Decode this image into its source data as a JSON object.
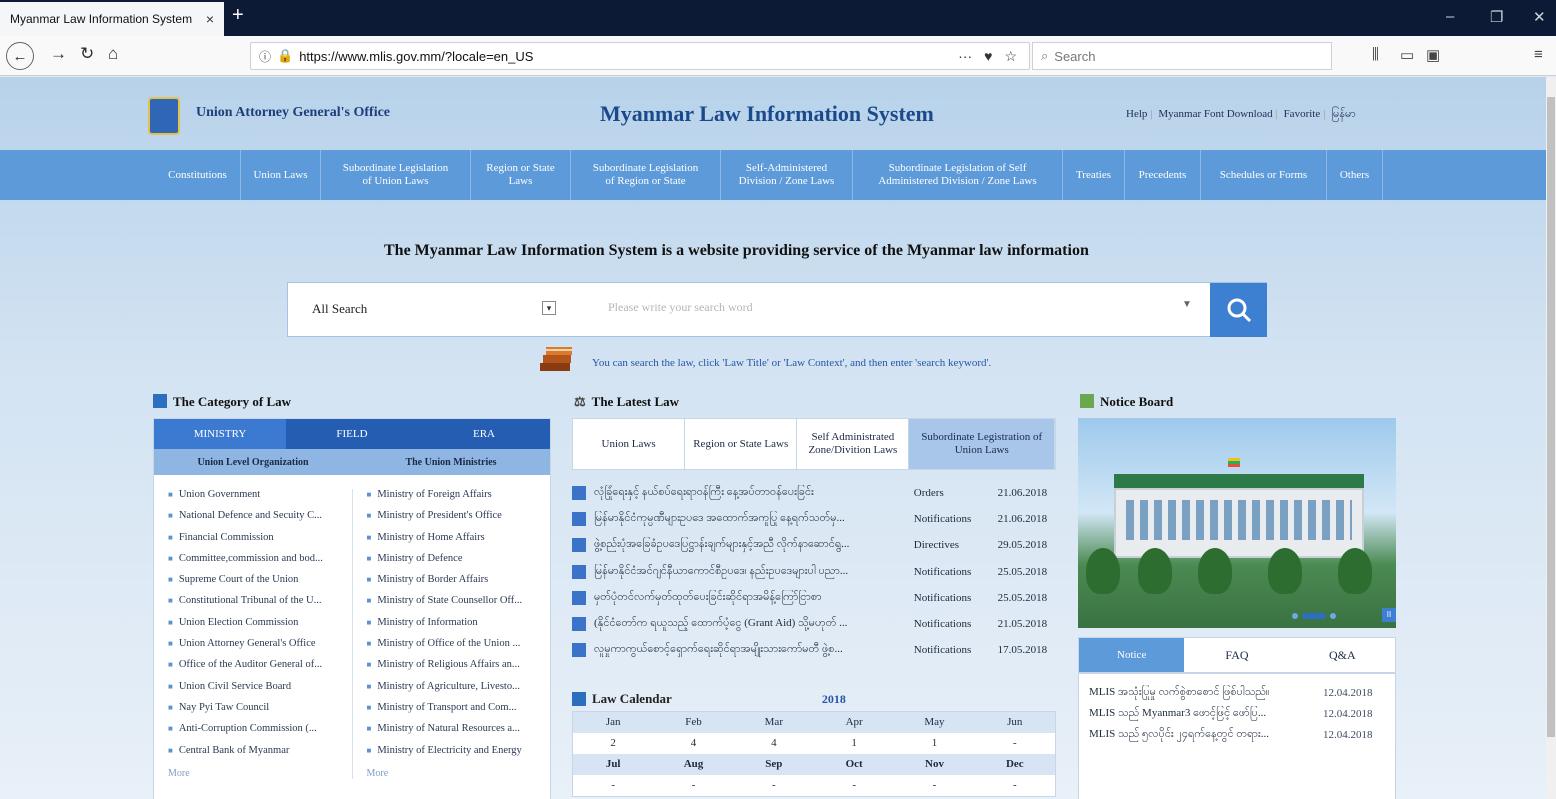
{
  "browser": {
    "tab_title": "Myanmar Law Information System",
    "tab_close": "×",
    "new_tab": "+",
    "url": "https://www.mlis.gov.mm/?locale=en_US",
    "page_actions": "···",
    "search_placeholder": "Search",
    "win_minimize": "–",
    "win_restore": "❐",
    "win_close": "✕"
  },
  "header": {
    "org_name": "Union Attorney General's Office",
    "site_title": "Myanmar Law Information System",
    "links": [
      "Help",
      "Myanmar Font Download",
      "Favorite",
      "မြန်မာ"
    ]
  },
  "menu": [
    "Constitutions",
    "Union Laws",
    "Subordinate Legislation of Union Laws",
    "Region or State Laws",
    "Subordinate Legislation of Region or State",
    "Self-Administered Division / Zone Laws",
    "Subordinate Legislation of Self Administered Division / Zone Laws",
    "Treaties",
    "Precedents",
    "Schedules or Forms",
    "Others"
  ],
  "tagline": "The Myanmar Law Information System is a website providing service of the Myanmar law information",
  "search": {
    "select_value": "All Search",
    "placeholder": "Please write your search word",
    "hint": "You can search the law, click 'Law Title' or 'Law Context', and then enter 'search keyword'."
  },
  "category": {
    "title": "The Category of Law",
    "tabs": [
      "MINISTRY",
      "FIELD",
      "ERA"
    ],
    "sub_headers": [
      "Union Level Organization",
      "The Union Ministries"
    ],
    "left_items": [
      "Union Government",
      "National Defence and Secuity C...",
      "Financial Commission",
      "Committee,commission and bod...",
      "Supreme Court of the Union",
      "Constitutional Tribunal of the U...",
      "Union Election Commission",
      "Union Attorney General's Office",
      "Office of the Auditor General of...",
      "Union Civil Service Board",
      "Nay Pyi Taw Council",
      "Anti-Corruption Commission (...",
      "Central Bank of Myanmar"
    ],
    "right_items": [
      "Ministry of Foreign Affairs",
      "Ministry of President's Office",
      "Ministry of Home Affairs",
      "Ministry of Defence",
      "Ministry of Border Affairs",
      "Ministry of State Counsellor Off...",
      "Ministry of Information",
      "Ministry of Office of the Union ...",
      "Ministry of Religious Affairs an...",
      "Ministry of Agriculture, Livesto...",
      "Ministry of Transport and Com...",
      "Ministry of Natural Resources a...",
      "Ministry of Electricity and Energy"
    ],
    "more": "More"
  },
  "latest_law": {
    "title": "The Latest Law",
    "tabs": [
      "Union Laws",
      "Region or State Laws",
      "Self Administrated Zone/Divition Laws",
      "Subordinate Legistration of Union Laws"
    ],
    "rows": [
      {
        "title": "လုံခြုံရေးနှင့် နယ်စပ်ရေးရာဝန်ကြီး နေ့အပ်တာဝန်ပေးခြင်း",
        "type": "Orders",
        "date": "21.06.2018"
      },
      {
        "title": "မြန်မာနိုင်ငံကုမ္ပဏီများဥပဒေ အထောက်အကူပြု နေ့ရက်သတ်မှ...",
        "type": "Notifications",
        "date": "21.06.2018"
      },
      {
        "title": "ဖွဲ့စည်းပုံအခြေခံဥပဒေပြဋ္ဌာန်းချက်များနှင့်အညီ လိုက်နာဆောင်ရွ...",
        "type": "Directives",
        "date": "29.05.2018"
      },
      {
        "title": "မြန်မာနိုင်ငံအင်ဂျင်နီယာကောင်စီဥပဒေ၊ နည်းဥပဒေများပါ ပညာ...",
        "type": "Notifications",
        "date": "25.05.2018"
      },
      {
        "title": "မှတ်ပုံတင်လက်မှတ်ထုတ်ပေးခြင်းဆိုင်ရာအမိန့်ကြော်ငြာစာ",
        "type": "Notifications",
        "date": "25.05.2018"
      },
      {
        "title": "(နိုင်ငံတော်က ရယူသည့် ထောက်ပံ့ငွေ (Grant Aid) သို့မဟုတ် ...",
        "type": "Notifications",
        "date": "21.05.2018"
      },
      {
        "title": "လူမှုကာကွယ်စောင့်ရှောက်ရေးဆိုင်ရာအမျိုးသားကော်မတီ ဖွဲ့စ...",
        "type": "Notifications",
        "date": "17.05.2018"
      }
    ]
  },
  "calendar": {
    "title": "Law Calendar",
    "year": "2018",
    "months_top": [
      "Jan",
      "Feb",
      "Mar",
      "Apr",
      "May",
      "Jun"
    ],
    "counts_top": [
      "2",
      "4",
      "4",
      "1",
      "1",
      "-"
    ],
    "months_bottom": [
      "Jul",
      "Aug",
      "Sep",
      "Oct",
      "Nov",
      "Dec"
    ],
    "counts_bottom": [
      "-",
      "-",
      "-",
      "-",
      "-",
      "-"
    ]
  },
  "notice_board": {
    "title": "Notice Board",
    "pause": "II",
    "tabs": [
      "Notice",
      "FAQ",
      "Q&A"
    ],
    "rows": [
      {
        "title": "MLIS အသုံးပြုမှု လက်စွဲစာစောင် ဖြစ်ပါသည်။",
        "date": "12.04.2018"
      },
      {
        "title": "MLIS သည် Myanmar3 ဖောင့်ဖြင့် ဖော်ပြ...",
        "date": "12.04.2018"
      },
      {
        "title": "MLIS သည် ၅လပိုင်း ၂၄ရက်နေ့တွင် တရား...",
        "date": "12.04.2018"
      }
    ]
  },
  "colors": {
    "menu_blue": "#5d9ad9",
    "tab_dark_blue": "#255db2",
    "accent_blue": "#3d7fd0"
  }
}
